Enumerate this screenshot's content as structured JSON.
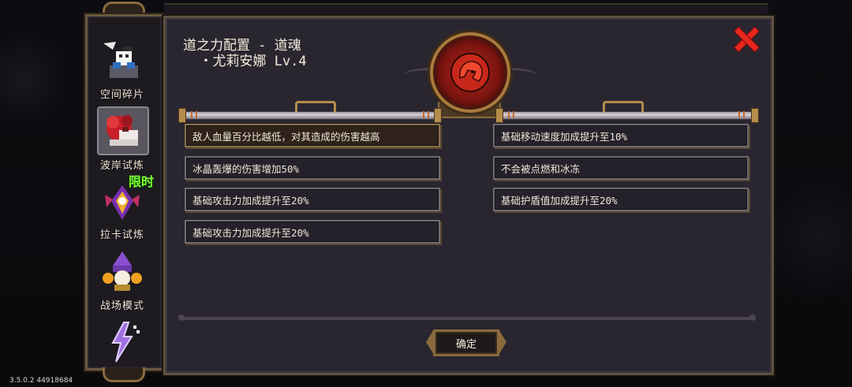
{
  "sidebar": {
    "items": [
      {
        "label": "空间碎片",
        "icon": "space-shard-icon"
      },
      {
        "label": "波岸试炼",
        "icon": "wave-shore-trial-icon",
        "active": true
      },
      {
        "label": "拉卡试炼",
        "icon": "raka-trial-icon",
        "badge": "限时"
      },
      {
        "label": "战场模式",
        "icon": "battlefield-mode-icon"
      },
      {
        "label": "",
        "icon": "lightning-mode-icon"
      }
    ]
  },
  "dialog": {
    "title": "道之力配置 - 道魂\n  ・尤莉安娜 Lv.4",
    "emblem_icon": "red-hair-portrait-icon",
    "close_icon": "close-icon",
    "left_effects": [
      "敌人血量百分比越低，对其造成的伤害越高",
      "冰晶轰爆的伤害增加50%",
      "基础攻击力加成提升至20%",
      "基础攻击力加成提升至20%"
    ],
    "right_effects": [
      "基础移动速度加成提升至10%",
      "不会被点燃和冰冻",
      "基础护盾值加成提升至20%"
    ],
    "confirm_label": "确定"
  },
  "version": "3.5.0.2 44918684",
  "colors": {
    "accent_gold": "#b58c4c",
    "close_red": "#e8271f",
    "limited_green": "#7dff3a",
    "panel": "#2a2630"
  }
}
